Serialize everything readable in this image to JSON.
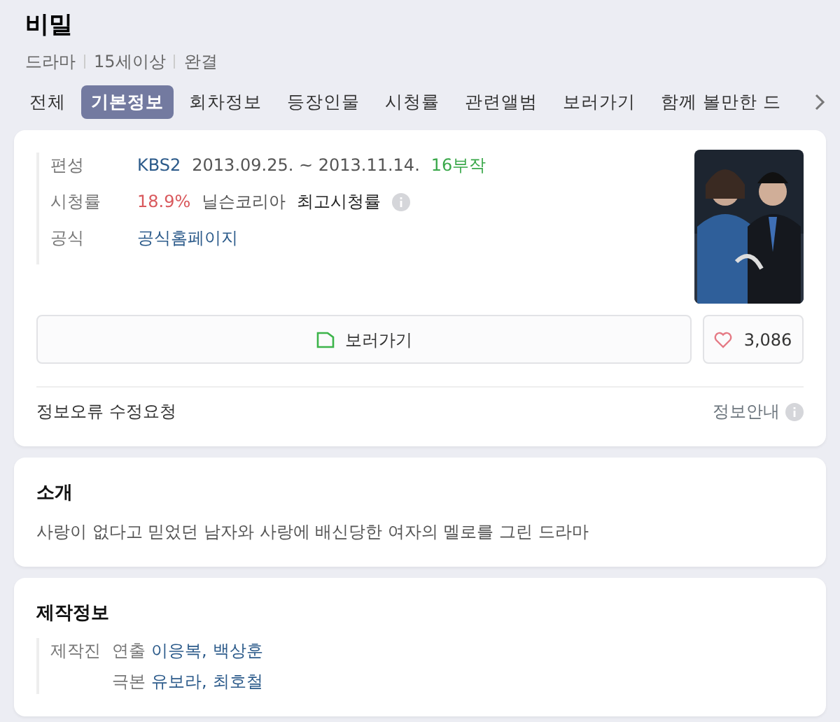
{
  "title": "비밀",
  "meta": [
    "드라마",
    "15세이상",
    "완결"
  ],
  "tabs": [
    {
      "label": "전체",
      "selected": false
    },
    {
      "label": "기본정보",
      "selected": true
    },
    {
      "label": "회차정보",
      "selected": false
    },
    {
      "label": "등장인물",
      "selected": false
    },
    {
      "label": "시청률",
      "selected": false
    },
    {
      "label": "관련앨범",
      "selected": false
    },
    {
      "label": "보러가기",
      "selected": false
    },
    {
      "label": "함께 볼만한 드",
      "selected": false
    }
  ],
  "info": {
    "rows": [
      {
        "label": "편성",
        "values": [
          {
            "text": "KBS2",
            "kind": "link"
          },
          {
            "text": "2013.09.25. ~ 2013.11.14.",
            "kind": "plain"
          },
          {
            "text": "16부작",
            "kind": "count"
          }
        ]
      },
      {
        "label": "시청률",
        "values": [
          {
            "text": "18.9%",
            "kind": "rating"
          },
          {
            "text": "닐슨코리아",
            "kind": "plain"
          },
          {
            "text": "최고시청률",
            "kind": "strong"
          },
          {
            "kind": "info"
          }
        ]
      },
      {
        "label": "공식",
        "values": [
          {
            "text": "공식홈페이지",
            "kind": "link"
          }
        ]
      }
    ],
    "watch_button": "보러가기",
    "likes": "3,086",
    "report_link": "정보오류 수정요청",
    "guide": "정보안내"
  },
  "intro": {
    "heading": "소개",
    "text": "사랑이 없다고 믿었던 남자와 사랑에 배신당한 여자의 멜로를 그린 드라마"
  },
  "production": {
    "heading": "제작정보",
    "label": "제작진",
    "roles": [
      {
        "role": "연출",
        "names": [
          "이응복,",
          "백상훈"
        ]
      },
      {
        "role": "극본",
        "names": [
          "유보라,",
          "최호철"
        ]
      }
    ]
  }
}
